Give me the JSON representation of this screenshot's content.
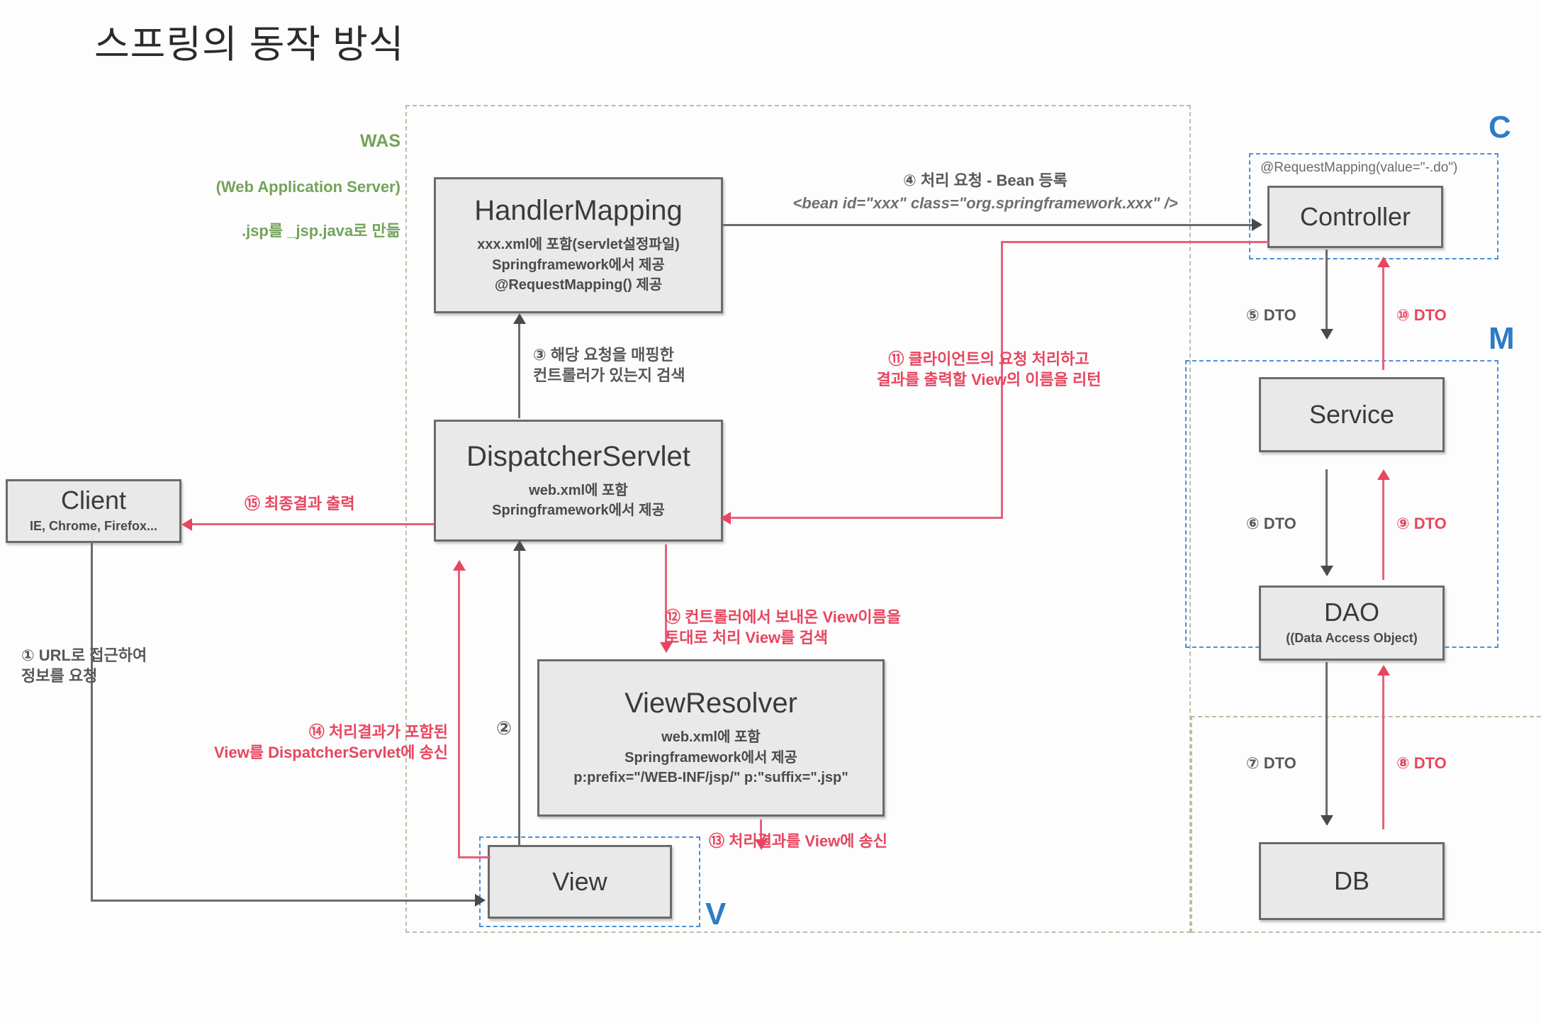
{
  "title": "스프링의 동작 방식",
  "was_label": {
    "line1": "WAS",
    "line2": "(Web Application Server)",
    "line3": ".jsp를 _jsp.java로 만듦"
  },
  "mvc_markers": {
    "c": "C",
    "m": "M",
    "v": "V"
  },
  "nodes": {
    "client": {
      "title": "Client",
      "sub": "IE, Chrome, Firefox..."
    },
    "handler_mapping": {
      "title": "HandlerMapping",
      "sub": "xxx.xml에 포함(servlet설정파일)\nSpringframework에서 제공\n@RequestMapping() 제공"
    },
    "dispatcher_servlet": {
      "title": "DispatcherServlet",
      "sub": "web.xml에 포함\nSpringframework에서 제공"
    },
    "view_resolver": {
      "title": "ViewResolver",
      "sub": "web.xml에 포함\nSpringframework에서 제공\np:prefix=\"/WEB-INF/jsp/\" p:\"suffix=\".jsp\""
    },
    "view": {
      "title": "View"
    },
    "controller": {
      "title": "Controller",
      "annotation": "@RequestMapping(value=\"-.do\")"
    },
    "service": {
      "title": "Service"
    },
    "dao": {
      "title": "DAO",
      "sub": "((Data Access Object)"
    },
    "db": {
      "title": "DB"
    }
  },
  "flow_labels": {
    "step1": "① URL로 접근하여\n정보를 요청",
    "step2": "②",
    "step3": "③ 해당 요청을 매핑한\n컨트롤러가 있는지 검색",
    "step4_line1": "④ 처리 요청 - Bean 등록",
    "step4_line2": "<bean id=\"xxx\" class=\"org.springframework.xxx\" />",
    "step5": "⑤ DTO",
    "step6": "⑥ DTO",
    "step7": "⑦ DTO",
    "step8": "⑧ DTO",
    "step9": "⑨ DTO",
    "step10": "⑩ DTO",
    "step11": "⑪ 클라이언트의 요청 처리하고\n결과를 출력할 View의 이름을 리턴",
    "step12": "⑫ 컨트롤러에서 보내온 View이름을\n토대로 처리 View를 검색",
    "step13": "⑬ 처리결과를 View에 송신",
    "step14": "⑭ 처리결과가 포함된\nView를 DispatcherServlet에 송신",
    "step15": "⑮ 최종결과 출력"
  },
  "colors": {
    "red": "#e8455f",
    "gray": "#585858",
    "green": "#73a35a",
    "blue": "#2e7cc4",
    "olive": "#b9bfa4",
    "node_fill": "#e9e9e9",
    "node_border": "#6b6b6b"
  }
}
